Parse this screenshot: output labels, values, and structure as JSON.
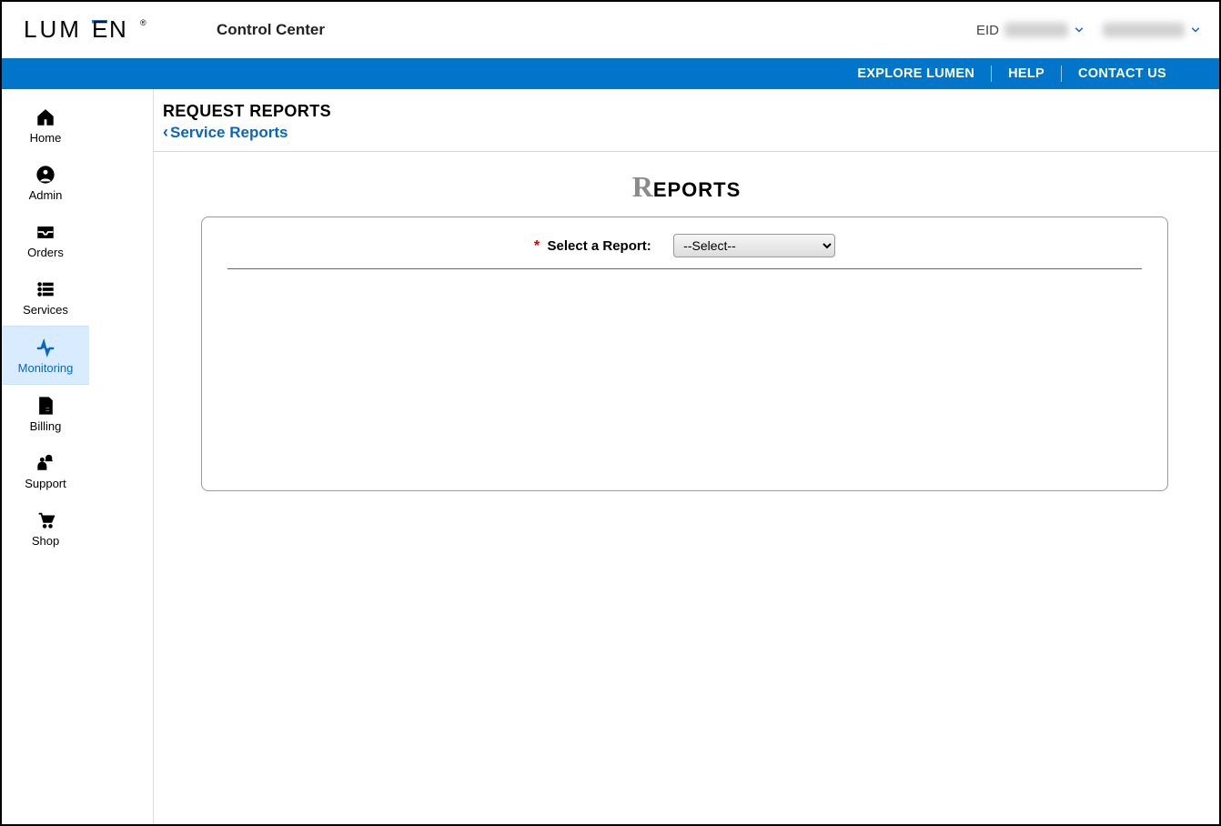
{
  "header": {
    "app_title": "Control Center",
    "eid_label": "EID"
  },
  "bluebar": {
    "explore": "EXPLORE LUMEN",
    "help": "HELP",
    "contact": "CONTACT US"
  },
  "sidebar": {
    "items": [
      {
        "id": "home",
        "label": "Home"
      },
      {
        "id": "admin",
        "label": "Admin"
      },
      {
        "id": "orders",
        "label": "Orders"
      },
      {
        "id": "services",
        "label": "Services"
      },
      {
        "id": "monitoring",
        "label": "Monitoring"
      },
      {
        "id": "billing",
        "label": "Billing"
      },
      {
        "id": "support",
        "label": "Support"
      },
      {
        "id": "shop",
        "label": "Shop"
      }
    ],
    "active": "monitoring"
  },
  "page": {
    "title": "REQUEST REPORTS",
    "back_link": "Service Reports",
    "section_title_cap": "R",
    "section_title_rest": "EPORTS",
    "select_label": "Select a Report:",
    "select_placeholder": "--Select--"
  }
}
